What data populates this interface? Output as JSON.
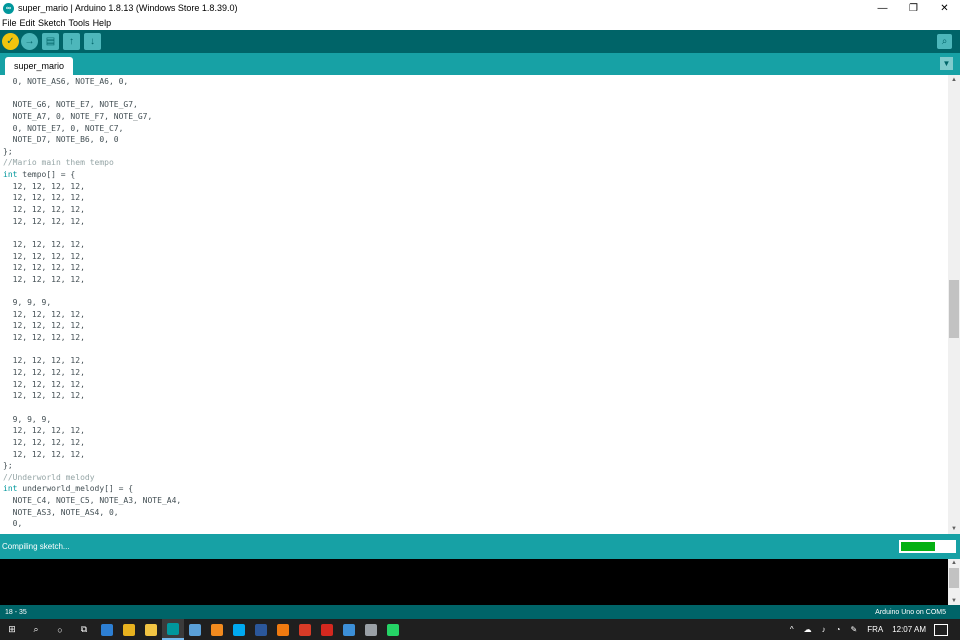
{
  "window": {
    "title": "super_mario | Arduino 1.8.13 (Windows Store 1.8.39.0)",
    "app_icon_glyph": "∞",
    "minimize_glyph": "—",
    "restore_glyph": "❐",
    "close_glyph": "✕"
  },
  "menu": {
    "items": [
      "File",
      "Edit",
      "Sketch",
      "Tools",
      "Help"
    ]
  },
  "toolbar": {
    "verify_glyph": "✓",
    "upload_glyph": "→",
    "new_glyph": "▤",
    "open_glyph": "↑",
    "save_glyph": "↓",
    "serial_monitor_glyph": "⌕"
  },
  "tabs": {
    "active_label": "super_mario",
    "tab_menu_glyph": "▼"
  },
  "editor": {
    "code_lines": [
      "  0, NOTE_AS6, NOTE_A6, 0,",
      "",
      "  NOTE_G6, NOTE_E7, NOTE_G7,",
      "  NOTE_A7, 0, NOTE_F7, NOTE_G7,",
      "  0, NOTE_E7, 0, NOTE_C7,",
      "  NOTE_D7, NOTE_B6, 0, 0",
      "};",
      "//Mario main them tempo",
      "int tempo[] = {",
      "  12, 12, 12, 12,",
      "  12, 12, 12, 12,",
      "  12, 12, 12, 12,",
      "  12, 12, 12, 12,",
      "",
      "  12, 12, 12, 12,",
      "  12, 12, 12, 12,",
      "  12, 12, 12, 12,",
      "  12, 12, 12, 12,",
      "",
      "  9, 9, 9,",
      "  12, 12, 12, 12,",
      "  12, 12, 12, 12,",
      "  12, 12, 12, 12,",
      "",
      "  12, 12, 12, 12,",
      "  12, 12, 12, 12,",
      "  12, 12, 12, 12,",
      "  12, 12, 12, 12,",
      "",
      "  9, 9, 9,",
      "  12, 12, 12, 12,",
      "  12, 12, 12, 12,",
      "  12, 12, 12, 12,",
      "};",
      "//Underworld melody",
      "int underworld_melody[] = {",
      "  NOTE_C4, NOTE_C5, NOTE_A3, NOTE_A4,",
      "  NOTE_AS3, NOTE_AS4, 0,",
      "  0,"
    ],
    "scroll_up_glyph": "▲",
    "scroll_down_glyph": "▼"
  },
  "status": {
    "message": "Compiling sketch...",
    "progress_fraction": 0.65
  },
  "footer": {
    "cursor_position": "18 - 35",
    "board_port": "Arduino Uno on COM5"
  },
  "taskbar": {
    "start_glyph": "⊞",
    "search_glyph": "⌕",
    "cortana_glyph": "○",
    "taskview_glyph": "⧉",
    "apps": [
      {
        "name": "edge",
        "color": "#2d7fd3"
      },
      {
        "name": "chrome",
        "color": "#e8b21f"
      },
      {
        "name": "file-explorer",
        "color": "#f2c443"
      },
      {
        "name": "arduino",
        "color": "#00979c"
      },
      {
        "name": "pen-app",
        "color": "#5aa0d8"
      },
      {
        "name": "sublime",
        "color": "#f28a1e"
      },
      {
        "name": "skype",
        "color": "#00a9f0"
      },
      {
        "name": "word",
        "color": "#2b579a"
      },
      {
        "name": "vlc",
        "color": "#f07a10"
      },
      {
        "name": "record-app",
        "color": "#d83b27"
      },
      {
        "name": "acrobat",
        "color": "#d4281f"
      },
      {
        "name": "mail",
        "color": "#3c8fd8"
      },
      {
        "name": "usb-app",
        "color": "#9aa0a6"
      },
      {
        "name": "whatsapp",
        "color": "#25d366"
      }
    ],
    "tray": {
      "chevron": "^",
      "language": "FRA",
      "time": "12:07 AM"
    }
  },
  "colors": {
    "toolbar": "#006468",
    "tab_bar": "#17a1a5",
    "keyword": "#00979c",
    "comment": "#95a5a6",
    "progress": "#05b012"
  }
}
